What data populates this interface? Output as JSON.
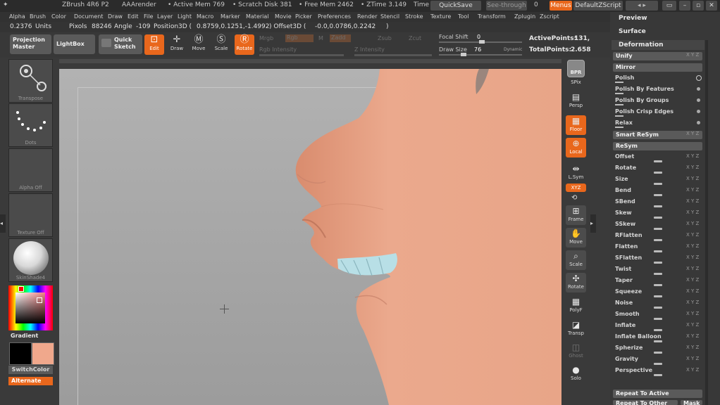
{
  "titlebar": {
    "app": "ZBrush 4R6 P2",
    "doc": "AAArender",
    "active_mem": "• Active Mem 769",
    "scratch_disk": "• Scratch Disk 381",
    "free_mem": "• Free Mem 2462",
    "ztime": "• ZTime 3.149",
    "time": "Time",
    "quicksave": "QuickSave",
    "see_through": "See-through",
    "see_through_value": "0",
    "menus": "Menus",
    "default_script": "DefaultZScript"
  },
  "menubar": [
    "Alpha",
    "Brush",
    "Color",
    "Document",
    "Draw",
    "Edit",
    "File",
    "Layer",
    "Light",
    "Macro",
    "Marker",
    "Material",
    "Movie",
    "Picker",
    "Preferences",
    "Render",
    "Stencil",
    "Stroke",
    "Texture",
    "Tool",
    "Transform",
    "Zplugin",
    "Zscript"
  ],
  "inforow": {
    "units_value": "0.2376",
    "units_label": "Units",
    "pixols_label": "Pixols",
    "pixols_value": "88246",
    "angle_label": "Angle",
    "angle_value": "-109",
    "position_label": "Position3D (",
    "position_value": "0.8759,0.1251,-1.4992",
    "offset_label": ") Offset3D (",
    "offset_value": "-0.0,0.0786,0.2242",
    "close_paren": ")"
  },
  "toolbar": {
    "projection_master": "Projection Master",
    "lightbox": "LightBox",
    "quick_sketch": "Quick Sketch",
    "edit": "Edit",
    "draw": "Draw",
    "move": "Move",
    "scale": "Scale",
    "rotate": "Rotate",
    "mrgb": "Mrgb",
    "rgb": "Rgb",
    "m": "M",
    "zadd": "Zadd",
    "zsub": "Zsub",
    "zcut": "Zcut",
    "rgb_intensity": "Rgb Intensity",
    "z_intensity": "Z Intensity",
    "focal_shift_label": "Focal Shift",
    "focal_shift_value": "0",
    "draw_size_label": "Draw Size",
    "draw_size_value": "76",
    "dynamic": "Dynamic",
    "active_points_label": "ActivePoints:",
    "active_points_value": "131,",
    "total_points_label": "TotalPoints:",
    "total_points_value": "2.658"
  },
  "leftshelf": {
    "transpose": "Transpose",
    "dots": "Dots",
    "alpha_off": "Alpha Off",
    "texture_off": "Texture Off",
    "material": "SkinShade4",
    "gradient": "Gradient",
    "switch_color": "SwitchColor",
    "alternate": "Alternate",
    "main_color": "#000000",
    "secondary_color": "#f0a88c"
  },
  "rightshelf": [
    "BPR",
    "SPix",
    "Persp",
    "Floor",
    "Local",
    "L.Sym",
    "XYZ",
    "Frame",
    "Move",
    "Scale",
    "Rotate",
    "PolyF",
    "Transp",
    "Ghost",
    "Solo"
  ],
  "rpanel": {
    "preview": "Preview",
    "surface": "Surface",
    "deformation": "Deformation",
    "unify": "Unify",
    "mirror": "Mirror",
    "polish_items": [
      "Polish",
      "Polish By Features",
      "Polish By Groups",
      "Polish Crisp Edges",
      "Relax"
    ],
    "smart_resym": "Smart ReSym",
    "resym": "ReSym",
    "deform_items": [
      "Offset",
      "Rotate",
      "Size",
      "Bend",
      "SBend",
      "Skew",
      "SSkew",
      "RFlatten",
      "Flatten",
      "SFlatten",
      "Twist",
      "Taper",
      "Squeeze",
      "Noise",
      "Smooth",
      "Inflate",
      "Inflate Balloon",
      "Spherize",
      "Gravity",
      "Perspective"
    ],
    "xyz_label": "X Y Z",
    "repeat_to_active": "Repeat To Active",
    "repeat_to_other": "Repeat To Other",
    "mask": "Mask"
  },
  "colors": {
    "accent": "#e9671c",
    "skin": "#e9a98c"
  }
}
